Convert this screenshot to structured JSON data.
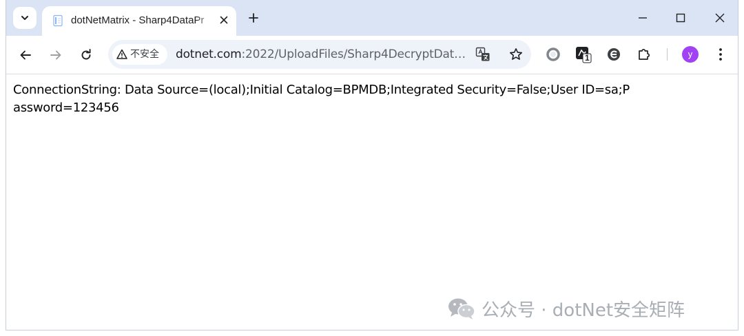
{
  "browser": {
    "tab": {
      "title": "dotNetMatrix - Sharp4DataPr",
      "favicon": "document-icon"
    },
    "new_tab_symbol": "+",
    "address_bar": {
      "security_label": "不安全",
      "url_host": "dotnet.com",
      "url_rest": ":2022/UploadFiles/Sharp4DecryptData..."
    },
    "profile_initial": "y",
    "extension_badge": "1",
    "accent_color": "#a142f4",
    "tabstrip_color": "#dbe4f5"
  },
  "page": {
    "content_text": "ConnectionString: Data Source=(local);Initial Catalog=BPMDB;Integrated Security=False;User ID=sa;Password=123456"
  },
  "watermark": {
    "text": "公众号 · dotNet安全矩阵"
  }
}
